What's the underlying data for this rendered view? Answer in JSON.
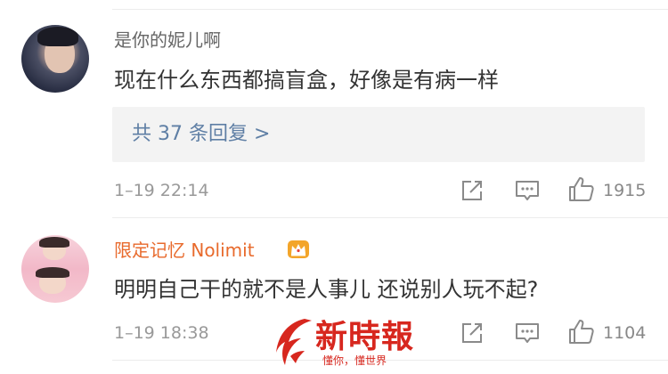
{
  "comments": [
    {
      "username": "是你的妮儿啊",
      "username_color": "#666666",
      "text": "现在什么东西都搞盲盒，好像是有病一样",
      "reply_link": "共 37 条回复 >",
      "timestamp": "1–19 22:14",
      "likes": "1915",
      "avatar": "avatar-photo"
    },
    {
      "username": "限定记忆 Nolimit",
      "username_color": "#e86a2c",
      "badge": "crown-icon",
      "text": "明明自己干的就不是人事儿 还说别人玩不起?",
      "timestamp": "1–19 18:38",
      "likes": "1104",
      "avatar": "avatar-photo"
    }
  ],
  "actions": {
    "share_icon": "share-icon",
    "comment_icon": "comment-icon",
    "like_icon": "like-icon"
  },
  "watermark": {
    "title": "新時報",
    "slogan": "懂你，懂世界",
    "color": "#d7271e"
  }
}
